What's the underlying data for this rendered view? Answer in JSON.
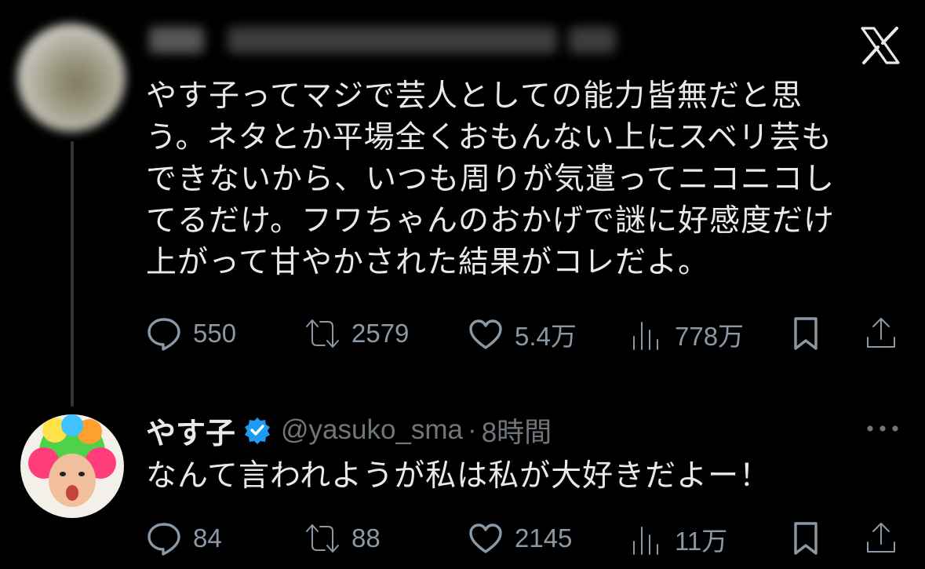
{
  "brand_logo": {
    "icon": "x-logo-icon",
    "label": "X"
  },
  "original_tweet": {
    "text": "やす子ってマジで芸人としての能力皆無だと思\nう。ネタとか平場全くおもんない上にスベリ芸も\nできないから、いつも周りが気遣ってニコニコし\nてるだけ。フワちゃんのおかげで謎に好感度だけ\n上がって甘やかされた結果がコレだよ。",
    "metrics": {
      "replies": "550",
      "reposts": "2579",
      "likes": "5.4万",
      "views": "778万"
    }
  },
  "reply_tweet": {
    "display_name": "やす子",
    "handle": "@yasuko_sma",
    "separator": "·",
    "time": "8時間",
    "text": "なんて言われようが私は私が大好きだよー！",
    "metrics": {
      "replies": "84",
      "reposts": "88",
      "likes": "2145",
      "views": "11万"
    }
  },
  "colors": {
    "background": "#000000",
    "text_primary": "#e7e9ea",
    "text_secondary": "#8b98a5",
    "verified_badge": "#1d9bf0",
    "thread_line": "#333639"
  }
}
